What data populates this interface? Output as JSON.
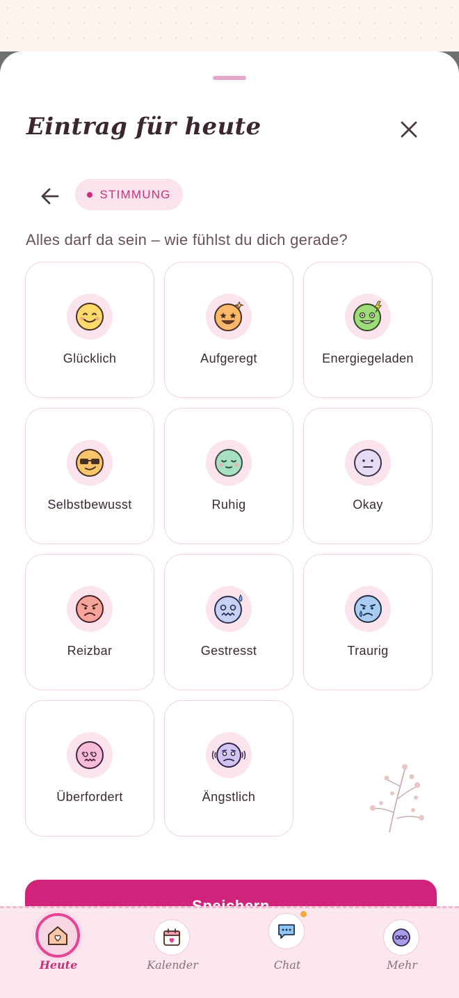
{
  "header": {
    "title": "Eintrag für heute",
    "close_icon": "close-icon"
  },
  "step": {
    "back_icon": "arrow-left-icon",
    "chip_label": "STIMMUNG",
    "prompt": "Alles darf da sein – wie fühlst du dich gerade?"
  },
  "moods": [
    {
      "label": "Glücklich",
      "icon": "happy-face-icon"
    },
    {
      "label": "Aufgeregt",
      "icon": "excited-face-icon"
    },
    {
      "label": "Energiegeladen",
      "icon": "energized-face-icon"
    },
    {
      "label": "Selbstbewusst",
      "icon": "sunglasses-face-icon"
    },
    {
      "label": "Ruhig",
      "icon": "calm-face-icon"
    },
    {
      "label": "Okay",
      "icon": "neutral-face-icon"
    },
    {
      "label": "Reizbar",
      "icon": "angry-face-icon"
    },
    {
      "label": "Gestresst",
      "icon": "stressed-face-icon"
    },
    {
      "label": "Traurig",
      "icon": "sad-face-icon"
    },
    {
      "label": "Überfordert",
      "icon": "overwhelmed-face-icon"
    },
    {
      "label": "Ängstlich",
      "icon": "anxious-face-icon"
    }
  ],
  "actions": {
    "save_label": "Speichern"
  },
  "nav": {
    "items": [
      {
        "label": "Heute",
        "icon": "home-heart-icon",
        "active": true
      },
      {
        "label": "Kalender",
        "icon": "calendar-heart-icon",
        "active": false
      },
      {
        "label": "Chat",
        "icon": "chat-bubble-icon",
        "active": false,
        "has_badge": true
      },
      {
        "label": "Mehr",
        "icon": "more-dots-icon",
        "active": false
      }
    ]
  },
  "colors": {
    "accent": "#d0237c",
    "chip_bg": "#fbe3ee",
    "card_border": "#f3d2df",
    "nav_bg": "#fce7ef",
    "badge": "#f1a93a"
  }
}
